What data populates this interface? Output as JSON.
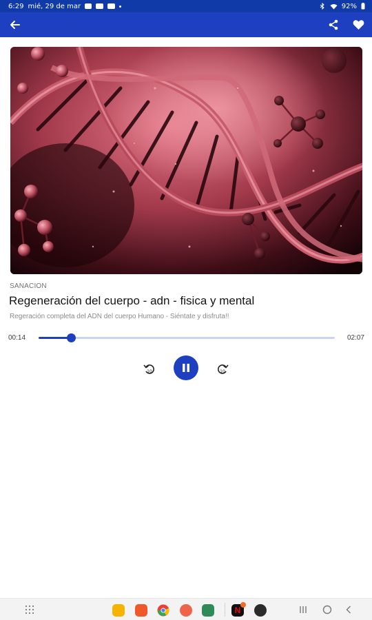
{
  "status_bar": {
    "time": "6:29",
    "date": "mié, 29 de mar",
    "battery": "92%"
  },
  "app_bar": {
    "back_icon": "arrow-left-icon",
    "share_icon": "share-icon",
    "favorite_icon": "heart-icon"
  },
  "track": {
    "category": "SANACION",
    "title": "Regeneración del cuerpo - adn - fisica y mental",
    "description": "Regeración completa del ADN del cuerpo Humano - Siéntate y disfruta!!"
  },
  "player": {
    "current_time": "00:14",
    "duration": "02:07",
    "progress": 0.11,
    "rewind_label": "10",
    "forward_label": "10",
    "state": "playing"
  },
  "nav_bar": {
    "dock_apps": [
      "app-drawer",
      "files",
      "notes",
      "chrome",
      "contacts",
      "calendar",
      "netflix",
      "game"
    ],
    "netflix_badge": "N"
  },
  "colors": {
    "primary": "#1e40c0",
    "status_bar": "#0f3aa8"
  }
}
